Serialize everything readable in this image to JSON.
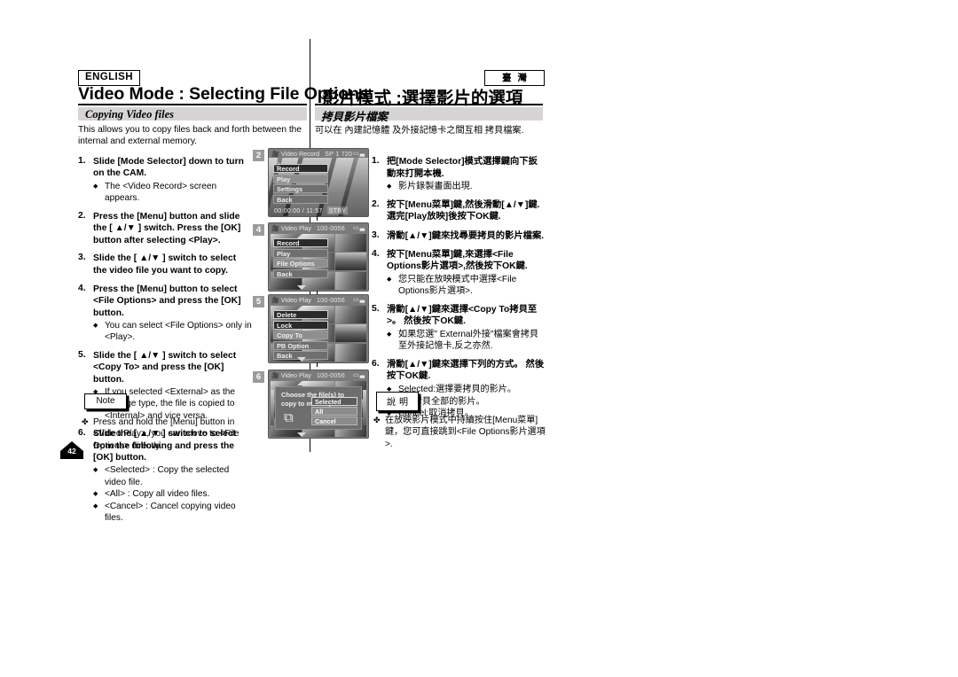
{
  "header": {
    "language_badge": "ENGLISH",
    "region_badge": "臺灣",
    "title_en": "Video Mode : Selecting File Options",
    "title_zh": "影片模式 :選擇影片的選項"
  },
  "section": {
    "heading_en": "Copying Video files",
    "heading_zh": "拷貝影片檔案",
    "intro_en": "This allows you to copy files back and forth between the internal and external memory.",
    "intro_zh": "可以在 內建記憶體 及外接記憶卡之間互相 拷貝檔案."
  },
  "steps_en": [
    {
      "num": "1.",
      "text": "Slide [Mode Selector] down to turn on the CAM.",
      "bullets": [
        "The <Video Record> screen appears."
      ]
    },
    {
      "num": "2.",
      "text": "Press the [Menu] button and slide the [ ▲/▼ ] switch. Press the [OK] button after selecting <Play>.",
      "bullets": []
    },
    {
      "num": "3.",
      "text": "Slide the [ ▲/▼ ] switch to select the video file you want to copy.",
      "bullets": []
    },
    {
      "num": "4.",
      "text": "Press the [Menu] button to select <File Options> and press the [OK] button.",
      "bullets": [
        "You can select <File Options> only in <Play>."
      ]
    },
    {
      "num": "5.",
      "text": "Slide the [ ▲/▼ ] switch to select <Copy To> and press the [OK] button.",
      "bullets": [
        "If you selected <External> as the Storage type, the file is copied to <Internal> and vice versa."
      ]
    },
    {
      "num": "6.",
      "text": "Slide the [ ▲/▼ ] switch to select from the following and press the [OK] button.",
      "bullets": [
        "<Selected> : Copy the selected video file.",
        "<All> : Copy all video files.",
        "<Cancel> : Cancel copying video files."
      ]
    }
  ],
  "steps_zh": [
    {
      "num": "1.",
      "text": "把[Mode Selector]模式選擇鍵向下扳動來打開本機.",
      "bullets": [
        "影片錄製畫面出現."
      ]
    },
    {
      "num": "2.",
      "text": "按下[Menu菜單]鍵,然後滑動[▲/▼]鍵. 選完[Play放映]後按下OK鍵.",
      "bullets": []
    },
    {
      "num": "3.",
      "text": "滑動[▲/▼]鍵來找尋要拷貝的影片檔案.",
      "bullets": []
    },
    {
      "num": "4.",
      "text": "按下[Menu菜單]鍵,來選擇<File Options影片選項>,然後按下OK鍵.",
      "bullets": [
        "您只能在放映模式中選擇<File Options影片選項>."
      ]
    },
    {
      "num": "5.",
      "text": "滑動[▲/▼]鍵來選擇<Copy To拷貝至>。 然後按下OK鍵.",
      "bullets": [
        "如果您選\" External外接\"檔案會拷貝至外接記憶卡,反之亦然."
      ]
    },
    {
      "num": "6.",
      "text": "滑動[▲/▼]鍵來選擇下列的方式。 然後按下OK鍵.",
      "bullets": [
        "Selected:選擇要拷貝的影片。",
        "All: 拷貝全部的影片。",
        "Cancel:取消拷貝。"
      ]
    }
  ],
  "note_en": {
    "label": "Note",
    "mark": "✤",
    "text": "Press and hold the [Menu] button in <Video Play>, you can move to <File Options> directly."
  },
  "note_zh": {
    "label": "說明",
    "mark": "✤",
    "text": "在放映影片模式中持續按住[Menu菜單]鍵，您可直接跳到<File Options影片選項>."
  },
  "page_number": "42",
  "screenshots": [
    {
      "badge": "2",
      "mode": "Video Record",
      "file_no": "",
      "status_right": "SP  1  720",
      "menu": [
        {
          "label": "Record",
          "state": "selected"
        },
        {
          "label": "Play",
          "state": "dim"
        },
        {
          "label": "Settings",
          "state": "normal"
        },
        {
          "label": "Back",
          "state": "normal"
        }
      ],
      "timecode": "00:00:00 / 11:57",
      "timecode_tag": "STBY",
      "type": "record"
    },
    {
      "badge": "4",
      "mode": "Video Play",
      "file_no": "100-0056",
      "status_right": "",
      "menu": [
        {
          "label": "Record",
          "state": "selected"
        },
        {
          "label": "Play",
          "state": "normal"
        },
        {
          "label": "File Options",
          "state": "dim"
        },
        {
          "label": "Back",
          "state": "normal"
        }
      ],
      "type": "list"
    },
    {
      "badge": "5",
      "mode": "Video Play",
      "file_no": "100-0056",
      "status_right": "",
      "menu": [
        {
          "label": "Delete",
          "state": "selected"
        },
        {
          "label": "Lock",
          "state": "selected"
        },
        {
          "label": "Copy To",
          "state": "dim"
        },
        {
          "label": "PB Option",
          "state": "normal"
        },
        {
          "label": "Back",
          "state": "normal"
        }
      ],
      "type": "list"
    },
    {
      "badge": "6",
      "mode": "Video Play",
      "file_no": "100-0056",
      "status_right": "",
      "dialog": {
        "question": "Choose the file(s) to copy to memory stick?",
        "options": [
          {
            "label": "Selected",
            "state": "selected"
          },
          {
            "label": "All",
            "state": "normal"
          },
          {
            "label": "Cancel",
            "state": "normal"
          }
        ]
      },
      "type": "dialog"
    }
  ],
  "colors": {
    "section_bar": "#d6d4d4",
    "badge_gray": "#9b9b9b",
    "lcd_bg": "#7b7b7b",
    "menu_selected": "#2b2b2b"
  }
}
